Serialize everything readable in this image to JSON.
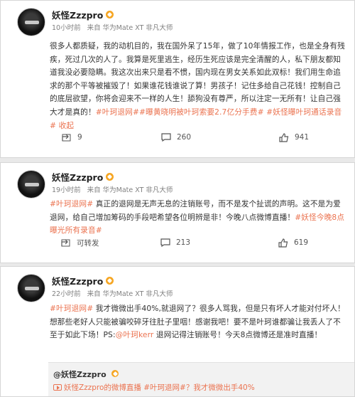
{
  "posts": [
    {
      "user": "妖怪Zzzpro",
      "time": "10小时前",
      "source": "来自 华为Mate XT 非凡大师",
      "text_plain": "很多人都质疑，我的动机目的，我在国外呆了15年，做了10年情报工作，也是全身有残疾，死过几次的人了。我算是死里逃生，经历生死应该是完全清醒的人，私下朋友都知道我没必要隐瞒。我这次出来只是看不惯，国内现在男女关系如此双标！我们用生命追求的那个平等被摧毁了！如果谁花钱谁说了算！男孩子！记住多给自己花钱！控制自己的底层欲望，你将会迎来不一样的人生！舔狗没有尊严，所以注定一无所有！让自己强大才是真的！",
      "topics": [
        "#叶珂退网#",
        "#曝黄晓明被叶珂索要2.7亿分手费#",
        "#妖怪曝叶珂通话录音#"
      ],
      "collapse_label": "收起",
      "share_count": "9",
      "comment_count": "260",
      "like_count": "941"
    },
    {
      "user": "妖怪Zzzpro",
      "time": "19小时前",
      "source": "来自 华为Mate XT 非凡大师",
      "topic_start": "#叶珂退网#",
      "text_plain": " 真正的退网是无声无息的注销账号，而不是发个扯谎的声明。这不是为爱退网，给自己增加筹码的手段吧希望各位明辨是非！今晚八点微博直播！",
      "topic_end": "#妖怪今晚8点曝光所有录音#",
      "share_count": "可转发",
      "comment_count": "213",
      "like_count": "619"
    },
    {
      "user": "妖怪Zzzpro",
      "time": "22小时前",
      "source": "来自 华为Mate XT 非凡大师",
      "topic_start": "#叶珂退网#",
      "text_a": " 我才微微出手40%,就退网了？很多人骂我，但是只有坏人才能对付坏人！想那些老好人只能被骗咬碎牙往肚子里咽！感谢我吧！要不是叶珂谁都骗让我丢人了不至于如此下场！PS:",
      "mention": "@叶珂kerr",
      "text_b": " 退网记得注销账号！今天8点微博还是准时直播！",
      "quote_user": "@妖怪Zzzpro",
      "quote_live": "妖怪Zzzpro的微博直播",
      "quote_topic": "#叶珂退网#",
      "quote_text": "？我才微微出手40%"
    }
  ],
  "colors": {
    "accent": "#eb7350",
    "vip": "#f6a623",
    "meta": "#808080"
  },
  "icons": [
    "share-icon",
    "comment-icon",
    "like-icon",
    "vip-badge-icon",
    "live-icon"
  ]
}
